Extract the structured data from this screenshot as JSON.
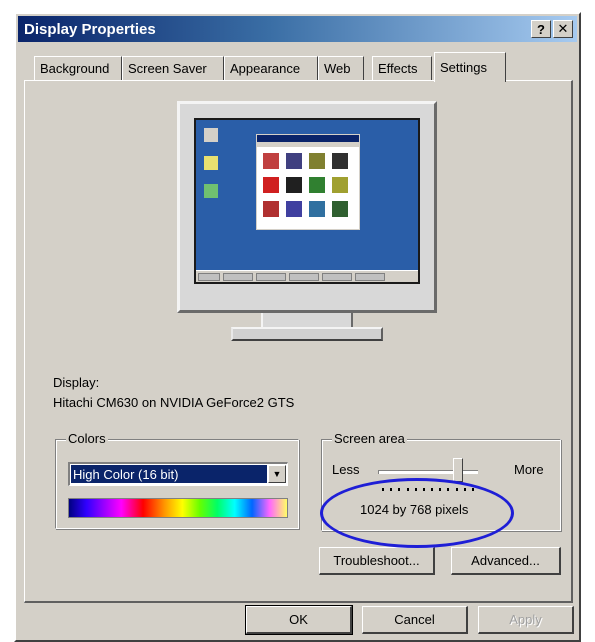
{
  "window": {
    "title": "Display Properties",
    "help_button": "?",
    "close_button": "✕"
  },
  "tabs": [
    {
      "label": "Background"
    },
    {
      "label": "Screen Saver"
    },
    {
      "label": "Appearance"
    },
    {
      "label": "Web"
    },
    {
      "label": "Effects"
    },
    {
      "label": "Settings",
      "active": true
    }
  ],
  "display": {
    "label": "Display:",
    "value": "Hitachi CM630 on NVIDIA GeForce2 GTS"
  },
  "colors": {
    "group_label": "Colors",
    "selected": "High Color (16 bit)",
    "dropdown_arrow": "▼"
  },
  "screen_area": {
    "group_label": "Screen area",
    "less_label": "Less",
    "more_label": "More",
    "resolution": "1024 by 768 pixels",
    "slider_position": 0.8
  },
  "buttons": {
    "troubleshoot": "Troubleshoot...",
    "advanced": "Advanced...",
    "ok": "OK",
    "cancel": "Cancel",
    "apply": "Apply"
  },
  "colors_palette": {
    "title_dark": "#0a246a",
    "title_light": "#a6caf0",
    "dialog_face": "#d4d0c8",
    "highlight_ellipse": "#1e1ed6",
    "preview_desktop": "#2a5ea8"
  }
}
